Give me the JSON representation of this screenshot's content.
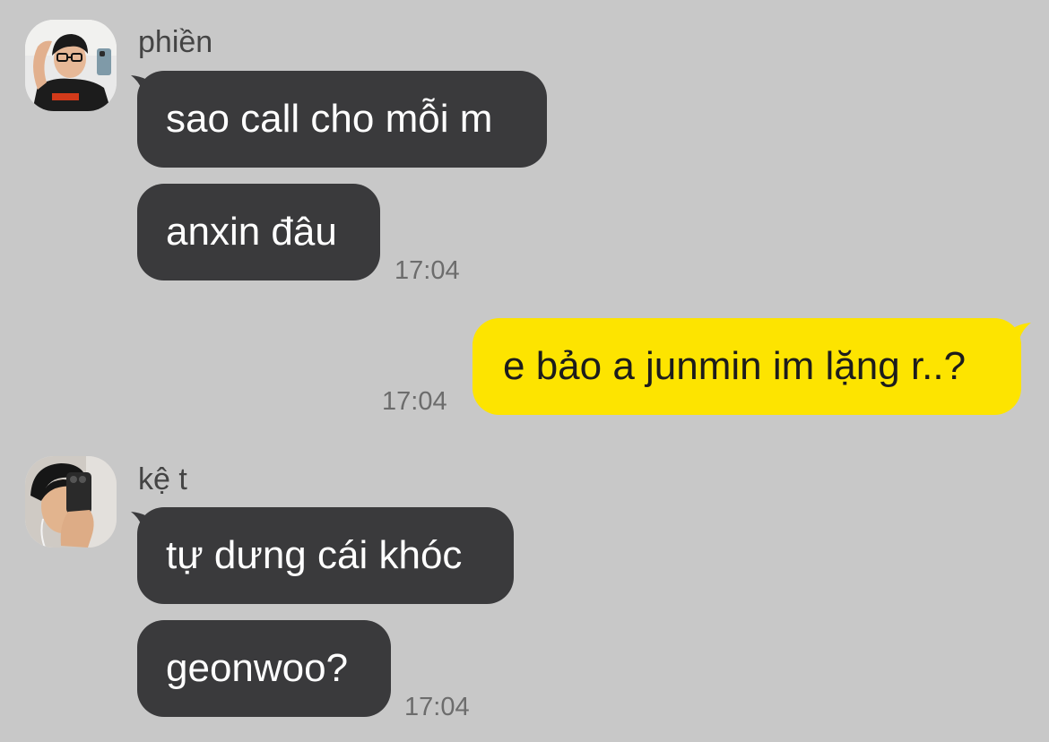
{
  "colors": {
    "background": "#c8c8c8",
    "incoming_bubble": "#3a3a3c",
    "outgoing_bubble": "#fde400",
    "incoming_text": "#ffffff",
    "outgoing_text": "#1c1c1c",
    "timestamp": "#6c6c6c"
  },
  "messages": {
    "group1": {
      "sender": "phiền",
      "avatar_icon": "user-photo-avatar",
      "bubbles": [
        "sao call cho mỗi m",
        "anxin đâu"
      ],
      "time": "17:04"
    },
    "outgoing": {
      "text": "e bảo a junmin im lặng r..?",
      "time": "17:04"
    },
    "group2": {
      "sender": "kệ t",
      "avatar_icon": "user-photo-avatar",
      "bubbles": [
        "tự dưng cái khóc",
        "geonwoo?"
      ],
      "time": "17:04"
    }
  }
}
